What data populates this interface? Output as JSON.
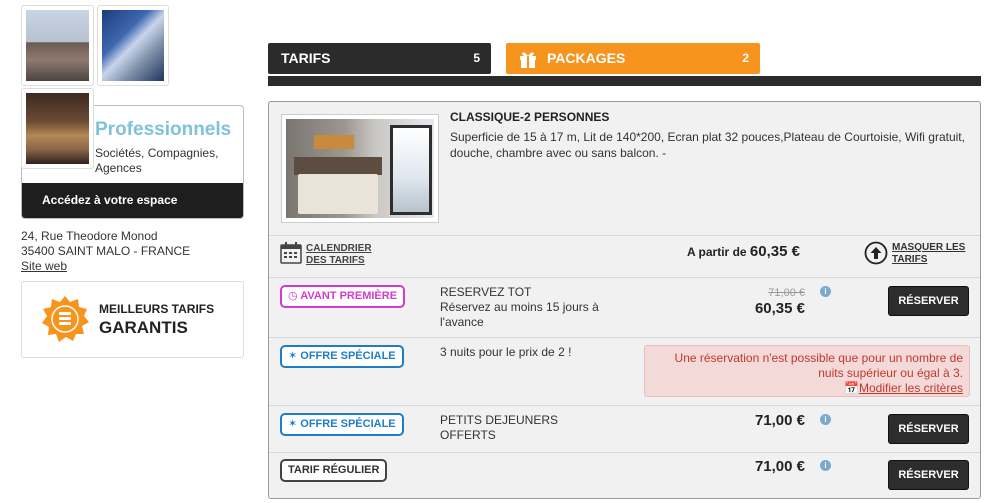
{
  "address": {
    "street": "24, Rue Theodore Monod",
    "city": "35400 SAINT MALO - FRANCE",
    "website": "Site web"
  },
  "pro": {
    "title": "Professionnels",
    "desc": "Sociétés, Compagnies, Agences",
    "access": "Accédez à votre espace"
  },
  "guarantee": {
    "line1": "MEILLEURS TARIFS",
    "line2": "GARANTIS"
  },
  "tabs": {
    "tarifs_label": "TARIFS",
    "tarifs_count": "5",
    "packages_label": "PACKAGES",
    "packages_count": "2"
  },
  "room": {
    "title": "CLASSIQUE-2 PERSONNES",
    "desc": "Superficie de 15 à 17 m, Lit de 140*200, Ecran plat 32 pouces,Plateau de Courtoisie, Wifi gratuit, douche, chambre avec ou sans balcon. -",
    "calendar_line1": "CALENDRIER",
    "calendar_line2": "DES TARIFS",
    "from_label": "A partir de",
    "from_price": "60,35 €",
    "mask_line1": "MASQUER LES",
    "mask_line2": "TARIFS"
  },
  "offers": [
    {
      "badge": "AVANT PREMIÈRE",
      "name": "RESERVEZ TOT",
      "detail": "Réservez au moins 15 jours à l'avance",
      "old_price": "71,00 €",
      "price": "60,35 €",
      "button": "RÉSERVER"
    },
    {
      "badge": "OFFRE SPÉCIALE",
      "name": "3 nuits pour le prix de 2 !",
      "warning": "Une réservation n'est possible que pour un nombre de nuits supérieur ou égal à 3.",
      "modify": "Modifier les critères"
    },
    {
      "badge": "OFFRE SPÉCIALE",
      "name": "PETITS DEJEUNERS OFFERTS",
      "price": "71,00 €",
      "button": "RÉSERVER"
    },
    {
      "badge": "TARIF RÉGULIER",
      "price": "71,00 €",
      "button": "RÉSERVER"
    }
  ],
  "colors": {
    "accent_orange": "#f7941d",
    "dark": "#2b2b2b",
    "pro_blue": "#7fc2dc",
    "pink": "#d23ccc",
    "blue": "#1f7cc7",
    "warning_bg": "#f4d9d9"
  },
  "icons": {
    "gift": "gift-icon",
    "calendar": "calendar-icon",
    "mask": "arrow-up-circle-icon",
    "info": "info-icon",
    "clock": "clock-icon",
    "star": "star-icon",
    "badge": "guarantee-badge-icon"
  }
}
